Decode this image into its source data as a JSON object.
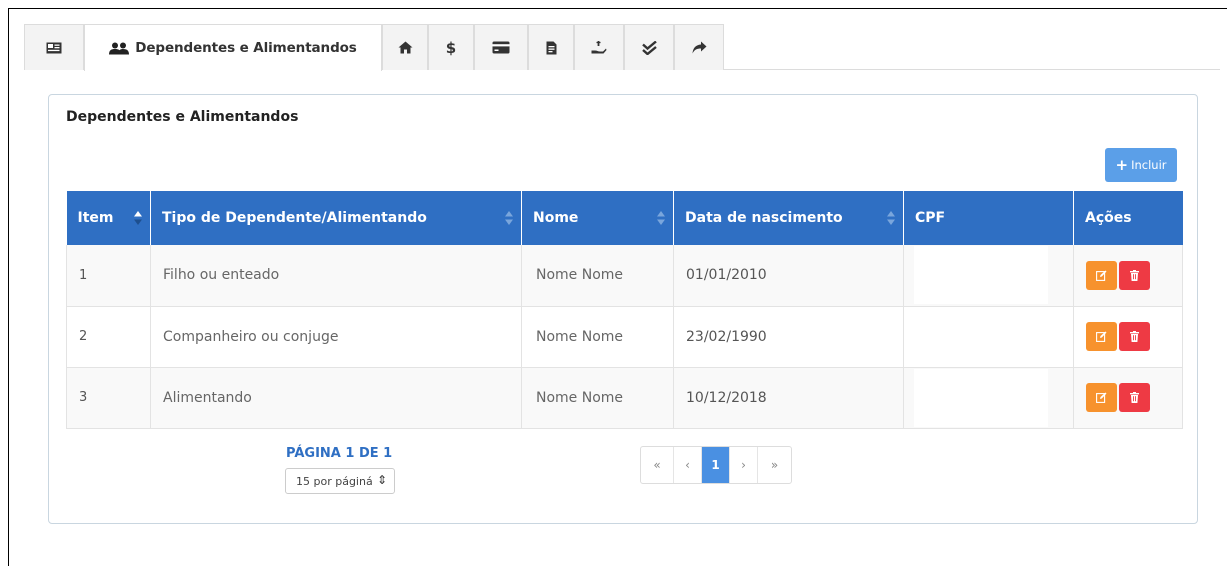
{
  "tabs": [
    {
      "icon": "id-card-icon"
    },
    {
      "icon": "users-icon",
      "label": "Dependentes e Alimentandos"
    },
    {
      "icon": "home-icon"
    },
    {
      "icon": "dollar-icon"
    },
    {
      "icon": "credit-card-icon"
    },
    {
      "icon": "document-icon"
    },
    {
      "icon": "hand-holding-dollar-icon"
    },
    {
      "icon": "double-check-icon"
    },
    {
      "icon": "share-arrow-icon"
    }
  ],
  "card": {
    "title": "Dependentes e Alimentandos",
    "include_label": "Incluir"
  },
  "table": {
    "headers": [
      "Item",
      "Tipo de Dependente/Alimentando",
      "Nome",
      "Data de nascimento",
      "CPF",
      "Ações"
    ],
    "rows": [
      {
        "item": "1",
        "tipo": "Filho ou enteado",
        "nome": "Nome Nome",
        "data": "01/01/2010",
        "cpf": ""
      },
      {
        "item": "2",
        "tipo": "Companheiro ou conjuge",
        "nome": "Nome Nome",
        "data": "23/02/1990",
        "cpf": ""
      },
      {
        "item": "3",
        "tipo": "Alimentando",
        "nome": "Nome Nome",
        "data": "10/12/2018",
        "cpf": ""
      }
    ]
  },
  "pagination": {
    "label": "PÁGINA 1 DE 1",
    "per_page": "15 por páginá",
    "first": "«",
    "prev": "‹",
    "current": "1",
    "next": "›",
    "last": "»"
  },
  "colors": {
    "header_blue": "#2f6fc3",
    "include_button": "#5b9fe8",
    "edit_orange": "#f7922d",
    "delete_red": "#ee3a44"
  }
}
